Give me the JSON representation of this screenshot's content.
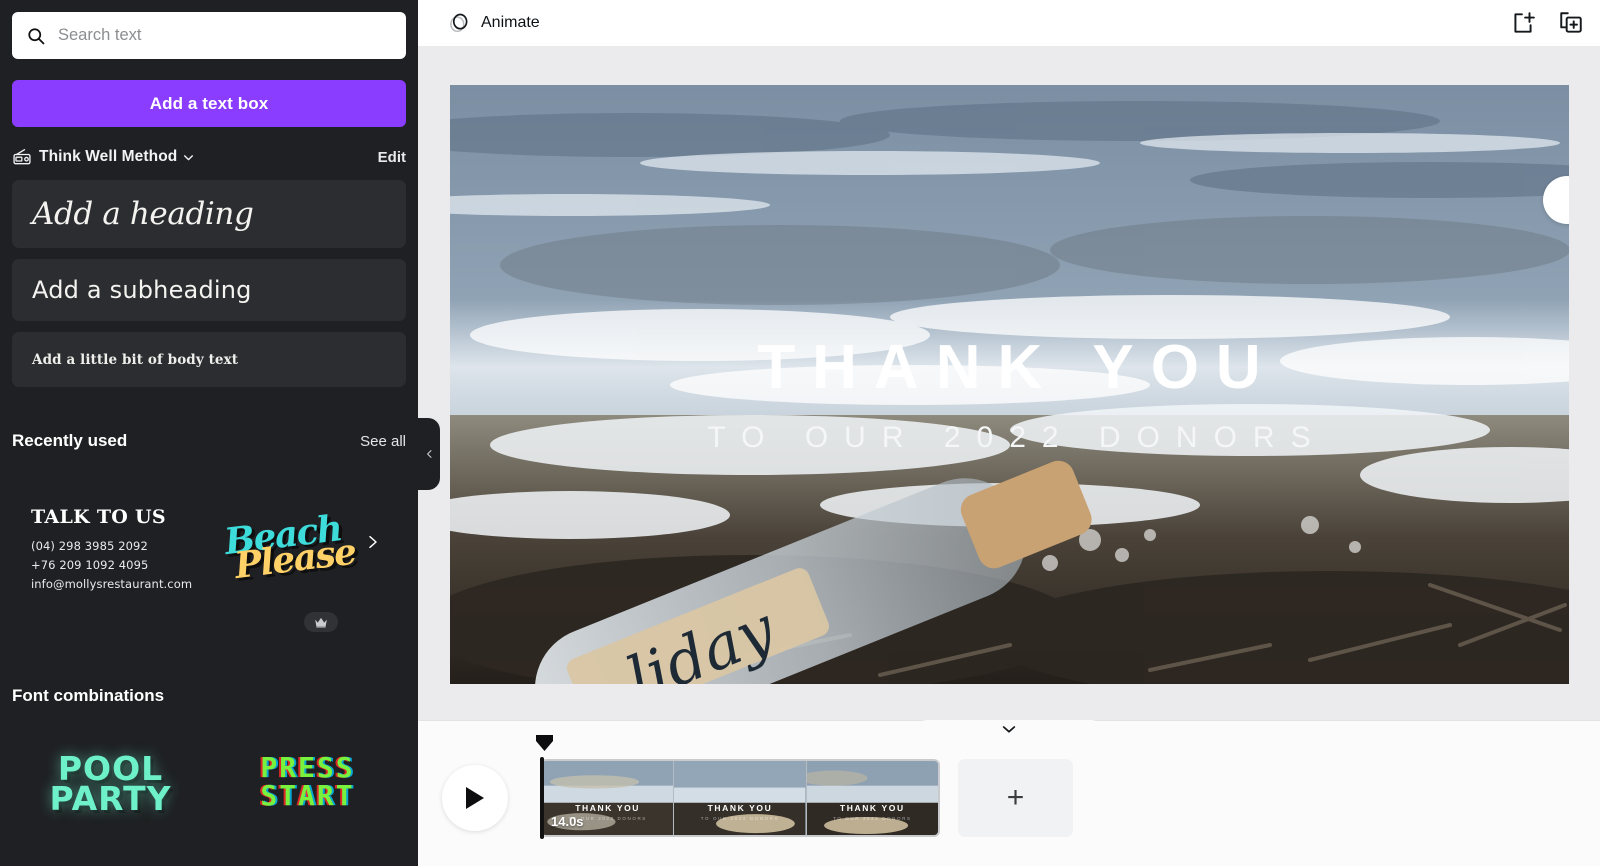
{
  "sidebar": {
    "search": {
      "placeholder": "Search text",
      "icon": "search-icon"
    },
    "add_text_button": "Add a text box",
    "brand": {
      "name": "Think Well Method",
      "icon": "brandkit-icon",
      "chevron": "chevron-down-icon",
      "edit_label": "Edit"
    },
    "text_styles": [
      {
        "label": "Add a heading",
        "style": "heading"
      },
      {
        "label": "Add a subheading",
        "style": "subheading"
      },
      {
        "label": "Add a little bit of body text",
        "style": "body"
      }
    ],
    "recently_used": {
      "title": "Recently used",
      "see_all": "See all",
      "cards": [
        {
          "type": "contact",
          "title": "TALK TO US",
          "lines": [
            "(04) 298 3985 2092",
            "+76 209 1092 4095",
            "info@mollysrestaurant.com"
          ]
        },
        {
          "type": "logo",
          "word_top": "Beach",
          "word_bottom": "Please",
          "color_top": "#3ddbd9",
          "color_bottom": "#ffd166",
          "badge": "crown-icon"
        }
      ],
      "next_arrow": "chevron-right-icon"
    },
    "font_combinations": {
      "title": "Font combinations",
      "items": [
        {
          "line1": "POOL",
          "line2": "PARTY",
          "color": "#6ef0c8"
        },
        {
          "line1": "PRESS",
          "line2": "START",
          "color": "#79f23d"
        }
      ]
    },
    "collapse_handle_icon": "chevron-left-icon",
    "background": "#1f2023",
    "accent": "#8b3dff"
  },
  "topbar": {
    "animate_label": "Animate",
    "animate_icon": "animate-circles-icon",
    "actions": [
      {
        "icon": "add-page-icon"
      },
      {
        "icon": "duplicate-page-icon"
      }
    ]
  },
  "canvas": {
    "main_text": "THANK YOU",
    "sub_text": "TO OUR 2022 DONORS",
    "background_description": "beach-wave-photo",
    "side_button_icon": "round-button"
  },
  "timeline": {
    "collapse_icon": "chevron-down-icon",
    "playhead_icon": "playhead-marker",
    "play_button_icon": "play-icon",
    "clip": {
      "duration": "14.0s",
      "frames": [
        {
          "label": "THANK YOU",
          "sublabel": "TO OUR 2022 DONORS"
        },
        {
          "label": "THANK YOU",
          "sublabel": "TO OUR 2022 DONORS"
        },
        {
          "label": "THANK YOU",
          "sublabel": "TO OUR 2022 DONORS"
        }
      ]
    },
    "add_page_label": "+"
  }
}
